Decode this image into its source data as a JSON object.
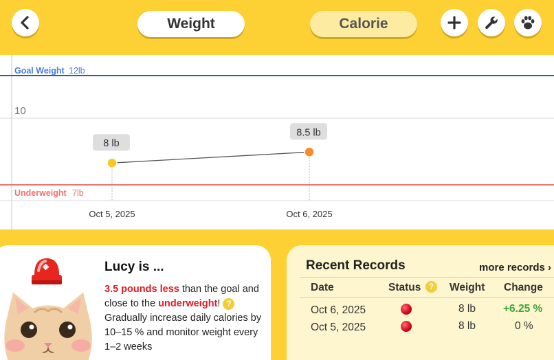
{
  "tabs": {
    "weight": "Weight",
    "calorie": "Calorie"
  },
  "chart_data": {
    "type": "line",
    "x": [
      "Oct 5, 2025",
      "Oct 6, 2025"
    ],
    "series": [
      {
        "values": [
          8,
          8.5
        ]
      }
    ],
    "data_labels": [
      "8 lb",
      "8.5 lb"
    ],
    "y_tick_labels": [
      "10"
    ],
    "goal_line": {
      "label": "Goal Weight",
      "value_label": "12lb",
      "value": 12,
      "color": "#3f4fb8"
    },
    "underweight_line": {
      "label": "Underweight",
      "value_label": "7lb",
      "value": 7,
      "color": "#f07272"
    },
    "point_colors": [
      "#f8c81e",
      "#fb8a2c"
    ],
    "line_color": "#555555",
    "grid": true
  },
  "status": {
    "title": "Lucy is ...",
    "highlight_1": "3.5 pounds less",
    "text_1": " than the goal and close to the ",
    "highlight_2": "underweight",
    "text_2": "!",
    "help": "?",
    "text_3": "Gradually increase daily calories by 10–15 % and monitor weight every 1–2 weeks"
  },
  "records": {
    "title": "Recent Records",
    "more": "more records",
    "more_arrow": "›",
    "headers": {
      "date": "Date",
      "status": "Status",
      "weight": "Weight",
      "change": "Change"
    },
    "status_help": "?",
    "rows": [
      {
        "date": "Oct 6, 2025",
        "weight": "8 lb",
        "change": "+6.25 %"
      },
      {
        "date": "Oct 5, 2025",
        "weight": "8 lb",
        "change": "0 %"
      }
    ]
  },
  "icons": {
    "back": "chevron-left-icon",
    "add": "plus-icon",
    "settings": "wrench-icon",
    "pet": "paw-icon"
  },
  "colors": {
    "background": "#fdd033",
    "alert_red": "#e31b23",
    "positive_green": "#3aa53a"
  }
}
